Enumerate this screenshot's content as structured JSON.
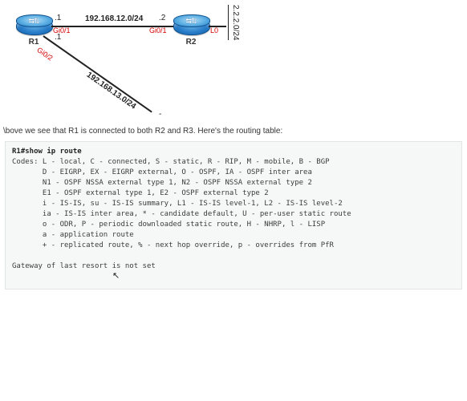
{
  "diagram": {
    "routers": {
      "r1": {
        "label": "R1"
      },
      "r2": {
        "label": "R2"
      }
    },
    "links": {
      "r1_r2": {
        "network": "192.168.12.0/24",
        "r1_end_octet": ".1",
        "r1_iface": "Gi0/1",
        "r2_end_octet": ".2",
        "r2_iface": "Gi0/1"
      },
      "r1_r3": {
        "network": "192.168.13.0/24",
        "r1_end_octet": ".1",
        "r1_iface": "Gi0/2",
        "r3_end_dash": "-"
      },
      "r2_lo": {
        "iface": "L0",
        "network": "2.2.2.0/24"
      }
    }
  },
  "description": "\\bove we see that R1 is connected to both R2 and R3. Here's the routing table:",
  "terminal": {
    "prompt_cmd": "R1#show ip route",
    "lines": [
      "Codes: L - local, C - connected, S - static, R - RIP, M - mobile, B - BGP",
      "       D - EIGRP, EX - EIGRP external, O - OSPF, IA - OSPF inter area",
      "       N1 - OSPF NSSA external type 1, N2 - OSPF NSSA external type 2",
      "       E1 - OSPF external type 1, E2 - OSPF external type 2",
      "       i - IS-IS, su - IS-IS summary, L1 - IS-IS level-1, L2 - IS-IS level-2",
      "       ia - IS-IS inter area, * - candidate default, U - per-user static route",
      "       o - ODR, P - periodic downloaded static route, H - NHRP, l - LISP",
      "       a - application route",
      "       + - replicated route, % - next hop override, p - overrides from PfR",
      "",
      "Gateway of last resort is not set"
    ]
  },
  "cursor_glyph": "↖"
}
